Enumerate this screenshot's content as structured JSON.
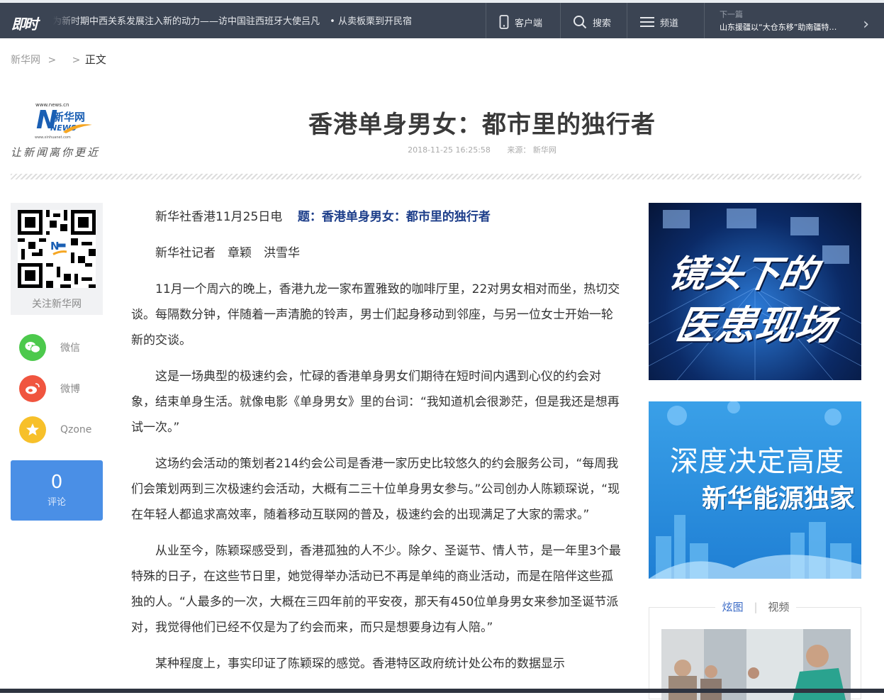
{
  "topbar": {
    "brand": "即时",
    "ticker": [
      "为新时期中西关系发展注入新的动力——访中国驻西班牙大使吕凡",
      "• 从卖板栗到开民宿"
    ],
    "client_label": "客户端",
    "search_label": "搜索",
    "channel_label": "频道",
    "next_label": "下一篇",
    "next_title": "山东援疆以“大仓东移”助南疆特…"
  },
  "breadcrumb": {
    "home": "新华网",
    "sep1": ">",
    "sep2": ">",
    "current": "正文"
  },
  "logo": {
    "url_top": "www.news.cn",
    "name": "新华网",
    "news": "NEWS",
    "url_bottom": "www.xinhuanet.com",
    "slogan": "让新闻离你更近"
  },
  "article": {
    "title": "香港单身男女：都市里的独行者",
    "datetime": "2018-11-25 16:25:58",
    "source": "来源：   新华网",
    "lead_prefix": "新华社香港11月25日电",
    "lead_title": "题：香港单身男女：都市里的独行者",
    "paragraphs": [
      "新华社记者　章颖　洪雪华",
      "11月一个周六的晚上，香港九龙一家布置雅致的咖啡厅里，22对男女相对而坐，热切交谈。每隔数分钟，伴随着一声清脆的铃声，男士们起身移动到邻座，与另一位女士开始一轮新的交谈。",
      "这是一场典型的极速约会，忙碌的香港单身男女们期待在短时间内遇到心仪的约会对象，结束单身生活。就像电影《单身男女》里的台词：“我知道机会很渺茫，但是我还是想再试一次。”",
      "这场约会活动的策划者214约会公司是香港一家历史比较悠久的约会服务公司，“每周我们会策划两到三次极速约会活动，大概有二三十位单身男女参与。”公司创办人陈颖琛说，“现在年轻人都追求高效率，随着移动互联网的普及，极速约会的出现满足了大家的需求。”",
      "从业至今，陈颖琛感受到，香港孤独的人不少。除夕、圣诞节、情人节，是一年里3个最特殊的日子，在这些节日里，她觉得举办活动已不再是单纯的商业活动，而是在陪伴这些孤独的人。“人最多的一次，大概在三四年前的平安夜，那天有450位单身男女来参加圣诞节派对，我觉得他们已经不仅是为了约会而来，而只是想要身边有人陪。”",
      "某种程度上，事实印证了陈颖琛的感觉。香港特区政府统计处公布的数据显示"
    ]
  },
  "sidebar_left": {
    "qr_label": "关注新华网",
    "wechat": "微信",
    "weibo": "微博",
    "qzone": "Qzone",
    "comment_count": "0",
    "comment_label": "评论"
  },
  "sidebar_right": {
    "ad1_line1": "镜头下的",
    "ad1_line2": "医患现场",
    "ad2_line1": "深度决定高度",
    "ad2_line2": "新华能源独家",
    "tab_active": "炫图",
    "tab_other": "视频"
  },
  "colors": {
    "topbar": "#3b4453",
    "accent_blue": "#4a8fe6",
    "wechat": "#4cc94c",
    "weibo": "#f0553f",
    "qzone": "#f7c02a",
    "headline_blue": "#1d3e8a"
  }
}
